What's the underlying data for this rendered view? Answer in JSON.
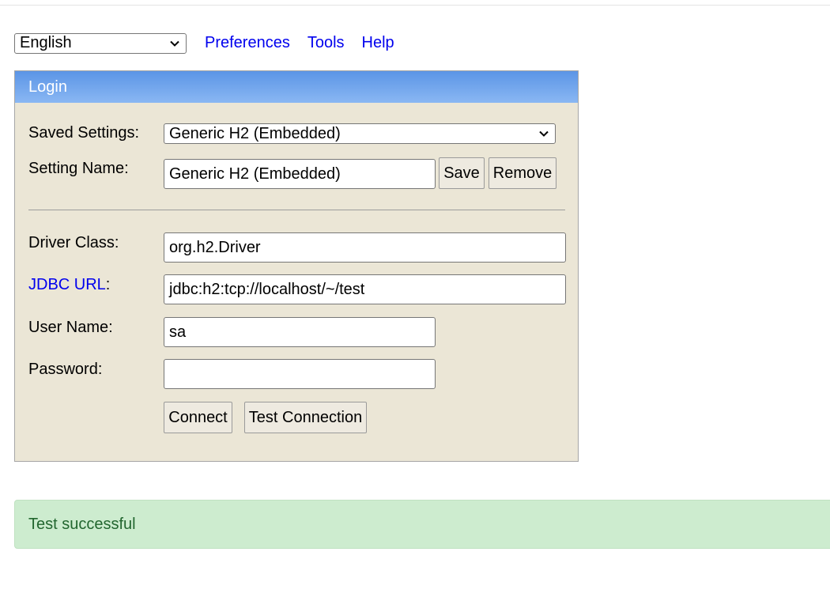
{
  "toolbar": {
    "language": "English",
    "links": [
      "Preferences",
      "Tools",
      "Help"
    ]
  },
  "login": {
    "title": "Login",
    "saved_settings_label": "Saved Settings:",
    "saved_settings_value": "Generic H2 (Embedded)",
    "setting_name_label": "Setting Name:",
    "setting_name_value": "Generic H2 (Embedded)",
    "save_label": "Save",
    "remove_label": "Remove",
    "driver_class_label": "Driver Class:",
    "driver_class_value": "org.h2.Driver",
    "jdbc_url_link": "JDBC URL",
    "jdbc_url_colon": ":",
    "jdbc_url_value": "jdbc:h2:tcp://localhost/~/test",
    "user_name_label": "User Name:",
    "user_name_value": "sa",
    "password_label": "Password:",
    "password_value": "",
    "connect_label": "Connect",
    "test_connection_label": "Test Connection"
  },
  "status": {
    "message": "Test successful"
  },
  "icons": {
    "dropdown": "chevron-down-icon"
  },
  "colors": {
    "header_start": "#5b95e6",
    "header_end": "#8ab7f3",
    "panel_bg": "#ebe6d6",
    "link": "#0000ee",
    "success_bg": "#cdeccf",
    "success_text": "#22662f"
  }
}
